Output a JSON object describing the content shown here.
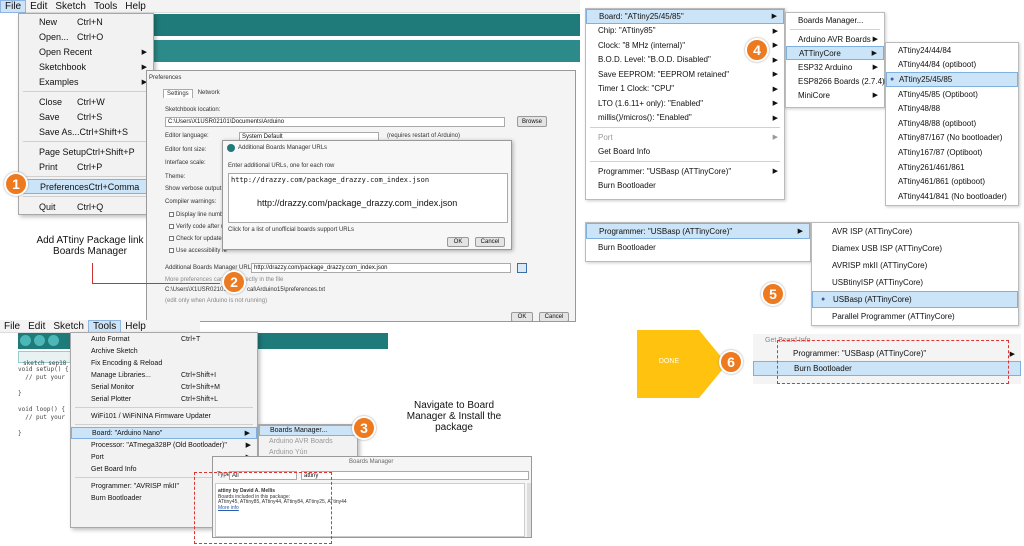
{
  "q1": {
    "menubar": [
      "File",
      "Edit",
      "Sketch",
      "Tools",
      "Help"
    ],
    "file_menu": [
      {
        "label": "New",
        "sc": "Ctrl+N"
      },
      {
        "label": "Open...",
        "sc": "Ctrl+O"
      },
      {
        "label": "Open Recent",
        "sc": "",
        "sub": true
      },
      {
        "label": "Sketchbook",
        "sc": "",
        "sub": true
      },
      {
        "label": "Examples",
        "sc": "",
        "sub": true
      },
      {
        "label": "Close",
        "sc": "Ctrl+W"
      },
      {
        "label": "Save",
        "sc": "Ctrl+S"
      },
      {
        "label": "Save As...",
        "sc": "Ctrl+Shift+S"
      },
      {
        "label": "Page Setup",
        "sc": "Ctrl+Shift+P"
      },
      {
        "label": "Print",
        "sc": "Ctrl+P"
      },
      {
        "label": "Preferences",
        "sc": "Ctrl+Comma",
        "highlight": true
      },
      {
        "label": "Quit",
        "sc": "Ctrl+Q"
      }
    ],
    "prefs": {
      "title": "Preferences",
      "tabs": [
        "Settings",
        "Network"
      ],
      "sketchbook_label": "Sketchbook location:",
      "sketchbook_path": "C:\\Users\\X1USR02101\\Documents\\Arduino",
      "browse": "Browse",
      "editor_language": "Editor language:",
      "language_value": "System Default",
      "restart_note": "(requires restart of Arduino)",
      "font_size": "Editor font size:",
      "interface_scale": "Interface scale:",
      "theme": "Theme:",
      "verbose": "Show verbose output d",
      "compiler_warnings": "Compiler warnings:",
      "chk1": "Display line numbe",
      "chk2": "Verify code after u",
      "chk3": "Check for updates",
      "chk4": "Use accessibility fe",
      "abm_label": "Additional Boards Manager URLs:",
      "abm_value": "http://drazzy.com/package_drazzy.com_index.json",
      "more_prefs": "More preferences can",
      "edit_directly": "irectly in the file",
      "prefs_path_a": "C:\\Users\\X1USR02101",
      "prefs_path_b": "cal\\Arduino15\\preferences.txt",
      "edit_note": "(edit only when Arduino is not running)",
      "ok": "OK",
      "cancel": "Cancel"
    },
    "abm_dialog": {
      "title": "Additional Boards Manager URLs",
      "instruction": "Enter additional URLs, one for each row",
      "url": "http://drazzy.com/package_drazzy.com_index.json",
      "url_large": "http://drazzy.com/package_drazzy.com_index.json",
      "link": "Click for a list of unofficial boards support URLs",
      "ok": "OK",
      "cancel": "Cancel"
    },
    "note": "Add ATtiny Package link\nBoards Manager"
  },
  "q2": {
    "board_menu": [
      {
        "label": "Board: \"ATtiny25/45/85\"",
        "sub": true,
        "highlight": true
      },
      {
        "label": "Chip: \"ATtiny85\"",
        "sub": true
      },
      {
        "label": "Clock: \"8 MHz (internal)\"",
        "sub": true
      },
      {
        "label": "B.O.D. Level: \"B.O.D. Disabled\"",
        "sub": true
      },
      {
        "label": "Save EEPROM: \"EEPROM retained\"",
        "sub": true
      },
      {
        "label": "Timer 1 Clock: \"CPU\"",
        "sub": true
      },
      {
        "label": "LTO (1.6.11+ only): \"Enabled\"",
        "sub": true
      },
      {
        "label": "millis()/micros(): \"Enabled\"",
        "sub": true
      },
      {
        "label": "Port",
        "sub": true,
        "disabled": true
      },
      {
        "label": "Get Board Info",
        "sub": false
      },
      {
        "label": "Programmer: \"USBasp (ATTinyCore)\"",
        "sub": true
      },
      {
        "label": "Burn Bootloader",
        "sub": false
      }
    ],
    "boards_sub": [
      {
        "label": "Boards Manager..."
      },
      {
        "label": "Arduino AVR Boards",
        "sub": true
      },
      {
        "label": "ATTinyCore",
        "sub": true,
        "highlight": true
      },
      {
        "label": "ESP32 Arduino",
        "sub": true
      },
      {
        "label": "ESP8266 Boards (2.7.4)",
        "sub": true
      },
      {
        "label": "MiniCore",
        "sub": true
      }
    ],
    "attiny_list": [
      "ATtiny24/44/84",
      "ATtiny44/84 (optiboot)",
      "ATtiny25/45/85",
      "ATtiny45/85 (Optiboot)",
      "ATtiny48/88",
      "ATtiny48/88 (optiboot)",
      "ATtiny87/167 (No bootloader)",
      "ATtiny167/87 (Optiboot)",
      "ATtiny261/461/861",
      "ATtiny461/861 (optiboot)",
      "ATtiny441/841 (No bootloader)"
    ],
    "attiny_selected": 2
  },
  "q3": {
    "menubar": [
      "File",
      "Edit",
      "Sketch",
      "Tools",
      "Help"
    ],
    "sketch_tab": "sketch_sep18",
    "code": [
      "void setup() {",
      "  // put your",
      "",
      "}",
      "",
      "void loop() {",
      "  // put your",
      "",
      "}"
    ],
    "tools_menu": [
      {
        "label": "Auto Format",
        "sc": "Ctrl+T"
      },
      {
        "label": "Archive Sketch",
        "sc": ""
      },
      {
        "label": "Fix Encoding & Reload",
        "sc": ""
      },
      {
        "label": "Manage Libraries...",
        "sc": "Ctrl+Shift+I"
      },
      {
        "label": "Serial Monitor",
        "sc": "Ctrl+Shift+M"
      },
      {
        "label": "Serial Plotter",
        "sc": "Ctrl+Shift+L"
      },
      {
        "label": "WiFi101 / WiFiNINA Firmware Updater",
        "sc": ""
      },
      {
        "label": "Board: \"Arduino Nano\"",
        "sc": "",
        "highlight": true,
        "sub": true
      },
      {
        "label": "Processor: \"ATmega328P (Old Bootloader)\"",
        "sc": "",
        "sub": true
      },
      {
        "label": "Port",
        "sc": "",
        "sub": true
      },
      {
        "label": "Get Board Info",
        "sc": ""
      },
      {
        "label": "Programmer: \"AVRISP mkII\"",
        "sc": "",
        "sub": true
      },
      {
        "label": "Burn Bootloader",
        "sc": ""
      }
    ],
    "board_sub": [
      "Boards Manager...",
      "Arduino AVR Boards",
      "Arduino Yún"
    ],
    "bm": {
      "title": "Boards Manager",
      "type_label": "Type",
      "type_value": "All",
      "search": "attiny",
      "pkg_title": "attiny by David A. Mellis",
      "pkg_line1": "Boards included in this package:",
      "pkg_line2": "ATtiny45, ATtiny85, ATtiny44, ATtiny84, ATtiny25, ATtiny44",
      "pkg_more": "More info"
    },
    "note": "Navigate to Board\nManager & Install the\npackage"
  },
  "q4": {
    "top": [
      {
        "label": "Programmer: \"USBasp (ATTinyCore)\"",
        "sub": true,
        "highlight": true
      },
      {
        "label": "Burn Bootloader",
        "sub": false
      }
    ],
    "programmers": [
      "AVR ISP (ATTinyCore)",
      "Diamex USB ISP (ATTinyCore)",
      "AVRISP mkII (ATTinyCore)",
      "USBtinyISP (ATTinyCore)",
      "USBasp (ATTinyCore)",
      "Parallel Programmer (ATTinyCore)"
    ],
    "prog_selected": 4,
    "done": "DONE",
    "final_top": "Get Board Info",
    "final_items": [
      "Programmer: \"USBasp (ATTinyCore)\"",
      "Burn Bootloader"
    ]
  },
  "badges": [
    "1",
    "2",
    "3",
    "4",
    "5",
    "6"
  ],
  "colors": {
    "badge": "#ee7a1f",
    "teal": "#1f7a7a",
    "done": "#ffc20e",
    "highlight": "#cce4f7"
  }
}
